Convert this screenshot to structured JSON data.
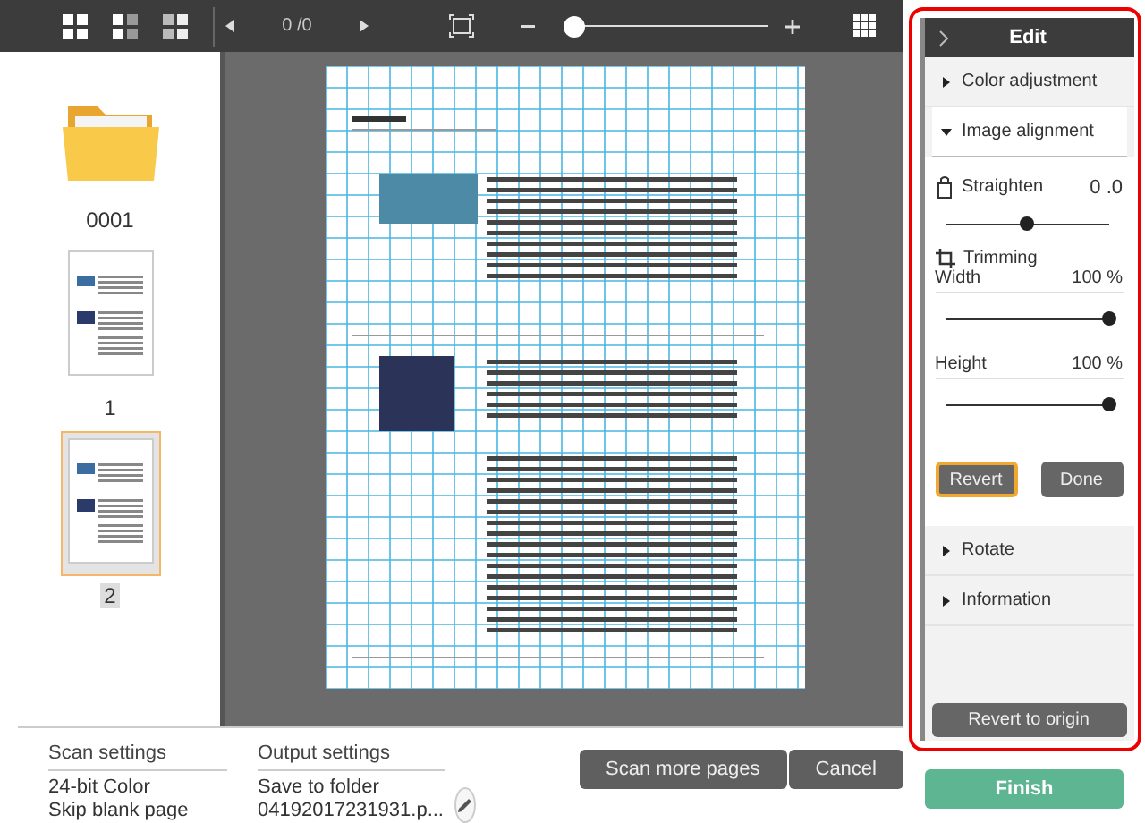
{
  "toolbar": {
    "page_counter": "0 /0",
    "zoom": {
      "level": 0.02
    }
  },
  "thumbnails": [
    {
      "kind": "folder",
      "label": "0001",
      "selected": false
    },
    {
      "kind": "page",
      "label": "1",
      "selected": false
    },
    {
      "kind": "page",
      "label": "2",
      "selected": true
    }
  ],
  "edit_panel": {
    "title": "Edit",
    "sections": [
      {
        "title": "Color adjustment",
        "expanded": false
      },
      {
        "title": "Image alignment",
        "expanded": true,
        "content": {
          "straighten": {
            "label": "Straighten",
            "value": "0 .0",
            "level": 0.5
          },
          "trimming": "Trimming",
          "width": {
            "label": "Width",
            "value": "100 %",
            "level": 1
          },
          "height": {
            "label": "Height",
            "value": "100 %",
            "level": 1
          },
          "buttons": [
            {
              "label": "Revert",
              "focused": true
            },
            {
              "label": "Done",
              "focused": false
            }
          ]
        }
      },
      {
        "title": "Rotate",
        "expanded": false
      },
      {
        "title": "Information",
        "expanded": false
      }
    ],
    "revert_to_origin": "Revert to origin"
  },
  "scan_settings": {
    "title": "Scan settings",
    "lines": [
      "24-bit Color",
      "Skip blank page"
    ]
  },
  "output_settings": {
    "title": "Output settings",
    "lines": [
      "Save to folder",
      "04192017231931.p..."
    ]
  },
  "bottom_buttons": [
    "Scan more pages",
    "Cancel"
  ],
  "finish_button": "Finish"
}
